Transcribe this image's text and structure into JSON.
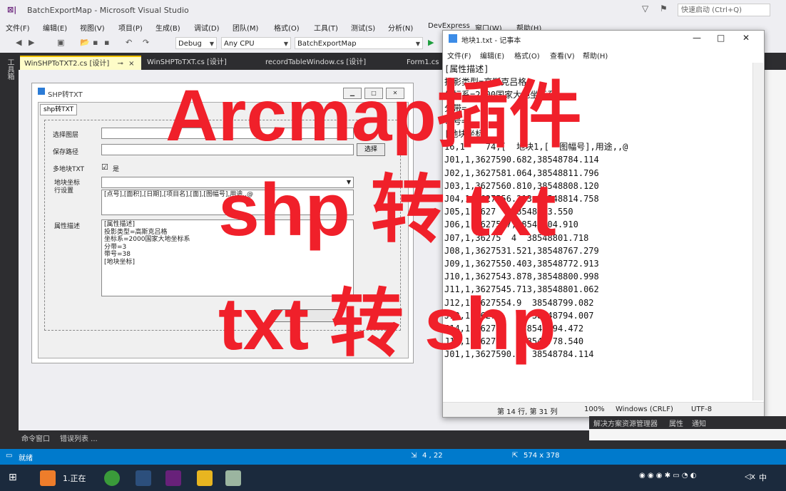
{
  "vs": {
    "title": "BatchExportMap - Microsoft Visual Studio",
    "logo": "⊠|",
    "quick_launch": "快速启动 (Ctrl+Q)",
    "menu": [
      "文件(F)",
      "编辑(E)",
      "视图(V)",
      "项目(P)",
      "生成(B)",
      "调试(D)",
      "团队(M)",
      "格式(O)",
      "工具(T)",
      "测试(S)",
      "分析(N)",
      "DevExpress",
      "窗口(W)",
      "帮助(H)"
    ],
    "config": "Debug",
    "platform": "Any CPU",
    "startup": "BatchExportMap",
    "toolbox_label": "工具箱",
    "tabs": [
      "WinSHPToTXT2.cs [设计]",
      "WinSHPToTXT.cs [设计]",
      "recordTableWindow.cs [设计]",
      "Form1.cs"
    ],
    "bottom_tabs": [
      "命令窗口",
      "错误列表 ..."
    ],
    "right_bottom_tabs": [
      "解决方案资源管理器",
      "属性",
      "通知"
    ],
    "status": {
      "ready": "就绪",
      "position": "4 , 22",
      "size": "574 x 378"
    }
  },
  "form": {
    "title": "SHP转TXT",
    "tab": "shp转TXT",
    "labels": {
      "select_layer": "选择图层",
      "save_path": "保存路径",
      "multi_block": "多地块TXT",
      "checkbox": "是",
      "coord_setting": "地块坐标\n行设置",
      "attr_desc": "属性描述"
    },
    "select_btn": "选择",
    "coord_row_value": "[点号],[面积],[日期],[项目名],[面],[图幅号],用途,,@",
    "attr_value": "[属性描述]\n投影类型=高斯克吕格\n坐标系=2000国家大地坐标系\n分带=3\n带号=38\n[地块坐标]"
  },
  "notepad": {
    "title": "地块1.txt - 记事本",
    "menu": [
      "文件(F)",
      "编辑(E)",
      "格式(O)",
      "查看(V)",
      "帮助(H)"
    ],
    "lines": [
      "[属性描述]",
      "投影类型=高斯克吕格",
      "坐标系=2000国家大地坐标系",
      "分带=",
      "带号=",
      "[地块坐标]",
      "16,1    74,[  地块1,[  图幅号],用途,,@",
      "J01,1,3627590.682,38548784.114",
      "J02,1,3627581.064,38548811.796",
      "J03,1,3627560.810,38548808.120",
      "J04,1,3627556.213,38548814.758",
      "J05,1,3627  ,38548813.550",
      "J06,1,36275 7,38548804.910",
      "J07,1,36275  4  38548801.718",
      "J08,1,3627531.521,38548767.279",
      "J09,1,3627550.403,38548772.913",
      "J10,1,3627543.878,38548800.998",
      "J11,1,3627545.713,38548801.062",
      "J12,1,3627554.9  38548799.082",
      "J13,1,36275   1  38548794.007",
      "J14,1,362756   38548794.472",
      "J15,1,362757   38548778.540",
      "J01,1,3627590.6  38548784.114"
    ],
    "status": {
      "position": "第 14 行, 第 31 列",
      "zoom": "100%",
      "eol": "Windows (CRLF)",
      "encoding": "UTF-8"
    }
  },
  "overlay": {
    "line1": "Arcmap插件",
    "line2": "shp 转 txt",
    "line3": "txt 转 shp"
  },
  "taskbar": {
    "item_text": "1.正在",
    "time": "中"
  }
}
